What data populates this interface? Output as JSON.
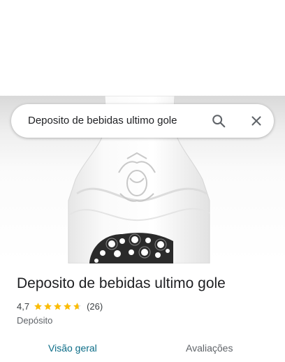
{
  "search": {
    "query": "Deposito de bebidas ultimo gole",
    "search_icon": "search-icon",
    "close_icon": "close-icon"
  },
  "place": {
    "name": "Deposito de bebidas ultimo gole",
    "rating": "4,7",
    "stars": 4.7,
    "reviews_count": "(26)",
    "category": "Depósito"
  },
  "tabs": [
    {
      "label": "Visão geral",
      "selected": true
    },
    {
      "label": "Avaliações",
      "selected": false
    }
  ],
  "colors": {
    "star": "#fbbc04",
    "tab_selected": "#0b6c87",
    "text_primary": "#202124",
    "text_secondary": "#5f6368"
  }
}
